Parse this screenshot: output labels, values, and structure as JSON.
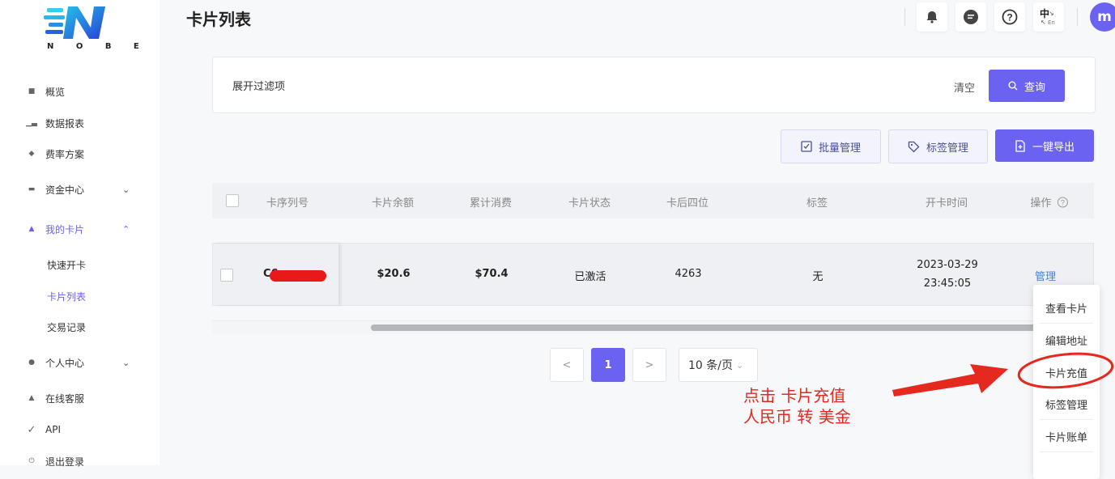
{
  "logo": {
    "text": "N O B E"
  },
  "sidebar": {
    "items": [
      {
        "label": "概览",
        "icon": "home-icon"
      },
      {
        "label": "数据报表",
        "icon": "chart-icon"
      },
      {
        "label": "费率方案",
        "icon": "diamond-icon"
      },
      {
        "label": "资金中心",
        "icon": "wallet-icon"
      },
      {
        "label": "我的卡片",
        "icon": "card-icon"
      },
      {
        "label": "个人中心",
        "icon": "user-icon"
      },
      {
        "label": "在线客服",
        "icon": "support-icon"
      },
      {
        "label": "API",
        "icon": "plug-icon"
      },
      {
        "label": "退出登录",
        "icon": "power-icon"
      }
    ],
    "card_submenu": [
      {
        "label": "快速开卡"
      },
      {
        "label": "卡片列表"
      },
      {
        "label": "交易记录"
      }
    ]
  },
  "header": {
    "title": "卡片列表",
    "lang_zh": "中",
    "lang_en": "En",
    "avatar_letter": "m"
  },
  "filter": {
    "toggle_label": "展开过滤项",
    "clear_label": "清空",
    "query_label": "查询"
  },
  "actions": {
    "batch_label": "批量管理",
    "tag_label": "标签管理",
    "export_label": "一键导出"
  },
  "table": {
    "headers": [
      "卡序列号",
      "卡片余额",
      "累计消费",
      "卡片状态",
      "卡后四位",
      "标签",
      "开卡时间",
      "操作"
    ],
    "rows": [
      {
        "serial": "C6",
        "balance": "$20.6",
        "spent": "$70.4",
        "status": "已激活",
        "last4": "4263",
        "tag": "无",
        "date": "2023-03-29",
        "time": "23:45:05",
        "op": "管理"
      }
    ]
  },
  "pagination": {
    "prev": "<",
    "current": "1",
    "next": ">",
    "page_size": "10 条/页"
  },
  "dropdown": {
    "items": [
      "查看卡片",
      "编辑地址",
      "卡片充值",
      "标签管理",
      "卡片账单"
    ]
  },
  "annotation": {
    "line1": "点击  卡片充值",
    "line2": "人民币 转 美金"
  },
  "colors": {
    "accent": "#6b62f2",
    "annotation_red": "#e5291f",
    "link_blue": "#4a7fd6"
  }
}
